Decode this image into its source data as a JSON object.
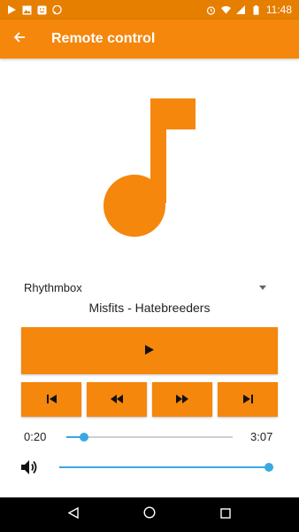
{
  "status_bar": {
    "time": "11:48",
    "left_icons": [
      "play-icon",
      "image-icon",
      "face-icon",
      "chat-icon"
    ],
    "right_icons": [
      "alarm-icon",
      "wifi-icon",
      "signal-icon",
      "battery-icon"
    ]
  },
  "app_bar": {
    "title": "Remote control",
    "back_icon": "arrow-back-icon"
  },
  "colors": {
    "accent": "#f5870c",
    "status_bar": "#e67e00",
    "slider": "#3aa8e3"
  },
  "player": {
    "selected": "Rhythmbox"
  },
  "track": {
    "title": "Misfits - Hatebreeders"
  },
  "controls": {
    "play_icon": "play-icon",
    "prev_icon": "skip-previous-icon",
    "rewind_icon": "rewind-icon",
    "forward_icon": "fast-forward-icon",
    "next_icon": "skip-next-icon"
  },
  "progress": {
    "current": "0:20",
    "total": "3:07",
    "fraction": 0.107
  },
  "volume": {
    "icon": "volume-icon",
    "fraction": 1.0
  },
  "nav_bar": {
    "icons": [
      "back-triangle-icon",
      "home-circle-icon",
      "recents-square-icon"
    ]
  }
}
